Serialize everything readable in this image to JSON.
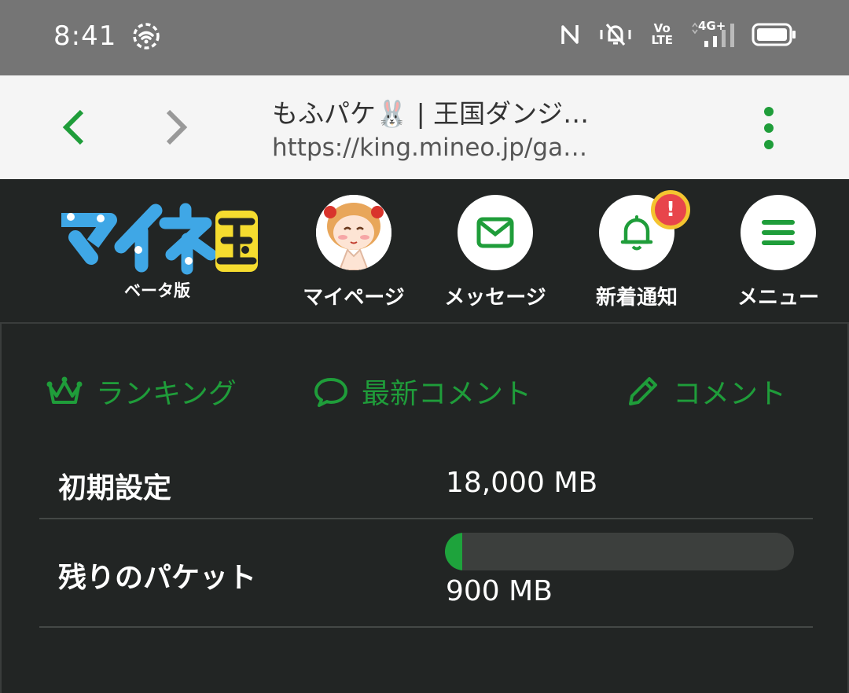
{
  "status_bar": {
    "time": "8:41",
    "icons": [
      "wifi-icon",
      "nfc-icon",
      "vibrate-silent-icon",
      "volte-icon",
      "signal-4g-icon",
      "battery-icon"
    ],
    "volte_top": "Vo",
    "volte_bottom": "LTE",
    "network": "4G+"
  },
  "browser": {
    "title": "もふパケ🐰 | 王国ダンジ…",
    "url": "https://king.mineo.jp/ga…",
    "accent": "#1f9d3a"
  },
  "header": {
    "logo_alt": "マイネ王",
    "logo_sub": "ベータ版",
    "nav": [
      {
        "label": "マイページ",
        "icon": "avatar-icon"
      },
      {
        "label": "メッセージ",
        "icon": "envelope-icon"
      },
      {
        "label": "新着通知",
        "icon": "bell-icon",
        "badge": "!"
      },
      {
        "label": "メニュー",
        "icon": "hamburger-icon"
      }
    ]
  },
  "tabs": [
    {
      "label": "ランキング",
      "icon": "crown-icon"
    },
    {
      "label": "最新コメント",
      "icon": "speech-bubble-icon"
    },
    {
      "label": "コメント",
      "icon": "pencil-icon"
    }
  ],
  "packet": {
    "initial_label": "初期設定",
    "initial_value": "18,000 MB",
    "remaining_label": "残りのパケット",
    "remaining_value": "900 MB",
    "remaining_fraction": 0.05,
    "bar_color": "#1ea33c"
  }
}
